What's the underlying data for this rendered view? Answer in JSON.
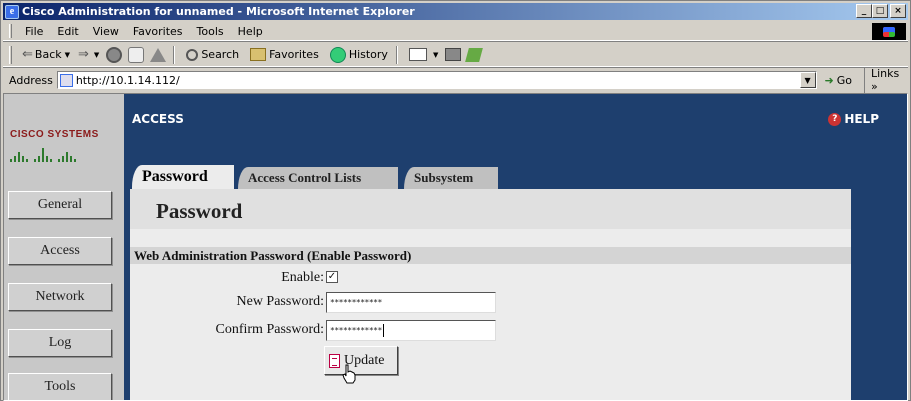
{
  "window": {
    "title": "Cisco Administration for unnamed - Microsoft Internet Explorer",
    "controls": [
      "_",
      "□",
      "×"
    ]
  },
  "menubar": {
    "items": [
      "File",
      "Edit",
      "View",
      "Favorites",
      "Tools",
      "Help"
    ]
  },
  "toolbar": {
    "back": "Back",
    "forward": "",
    "search": "Search",
    "favorites": "Favorites",
    "history": "History"
  },
  "addressbar": {
    "label": "Address",
    "url": "http://10.1.14.112/",
    "go": "Go",
    "links": "Links »"
  },
  "sidebar": {
    "brand": "CISCO SYSTEMS",
    "items": [
      {
        "label": "General"
      },
      {
        "label": "Access"
      },
      {
        "label": "Network"
      },
      {
        "label": "Log"
      },
      {
        "label": "Tools"
      }
    ]
  },
  "header": {
    "section": "ACCESS",
    "help": "HELP"
  },
  "tabs": [
    {
      "label": "Password",
      "active": true
    },
    {
      "label": "Access Control Lists",
      "active": false
    },
    {
      "label": "Subsystem",
      "active": false
    }
  ],
  "panel": {
    "title": "Password",
    "subheading": "Web Administration Password (Enable Password)",
    "enable_label": "Enable:",
    "enable_checked": true,
    "enable_mark": "✓",
    "new_password_label": "New Password:",
    "new_password_value": "************",
    "confirm_password_label": "Confirm Password:",
    "confirm_password_value": "************",
    "update_label": "Update"
  },
  "colors": {
    "main_bg": "#1e3f6e",
    "brand": "#8b1a1a",
    "title_bar": "#0a246a"
  }
}
